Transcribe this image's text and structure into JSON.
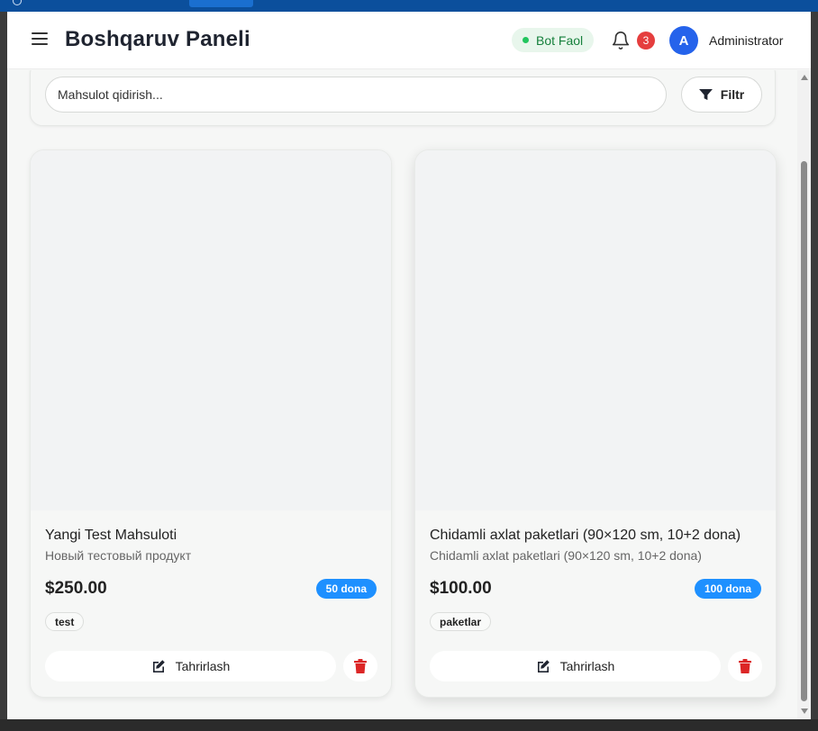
{
  "header": {
    "title": "Boshqaruv Paneli",
    "bot_status": "Bot Faol",
    "notification_count": "3",
    "avatar_initial": "A",
    "user_name": "Administrator"
  },
  "search": {
    "placeholder": "Mahsulot qidirish...",
    "filter_label": "Filtr"
  },
  "products": [
    {
      "name": "Yangi Test Mahsuloti",
      "description": "Новый тестовый продукт",
      "price": "$250.00",
      "stock": "50 dona",
      "tag": "test",
      "edit_label": "Tahrirlash"
    },
    {
      "name": "Chidamli axlat paketlari (90×120 sm, 10+2 dona)",
      "description": "Chidamli axlat paketlari (90×120 sm, 10+2 dona)",
      "price": "$100.00",
      "stock": "100 dona",
      "tag": "paketlar",
      "edit_label": "Tahrirlash"
    }
  ],
  "colors": {
    "accent": "#2563eb",
    "stock_badge": "#1e90ff",
    "danger": "#e53e3e",
    "bot_active": "#22c55e"
  },
  "icons": [
    "menu-icon",
    "bell-icon",
    "filter-icon",
    "edit-icon",
    "trash-icon"
  ]
}
